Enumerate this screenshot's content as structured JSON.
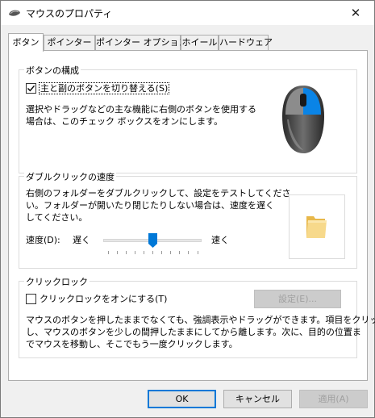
{
  "window": {
    "title": "マウスのプロパティ",
    "close_symbol": "✕"
  },
  "tabs": [
    {
      "label": "ボタン",
      "active": true
    },
    {
      "label": "ポインター",
      "active": false
    },
    {
      "label": "ポインター オプション",
      "active": false
    },
    {
      "label": "ホイール",
      "active": false
    },
    {
      "label": "ハードウェア",
      "active": false
    }
  ],
  "button_config": {
    "group_title": "ボタンの構成",
    "swap_checkbox_label": "主と副のボタンを切り替える(S)",
    "swap_checked": true,
    "description_line1": "選択やドラッグなどの主な機能に右側のボタンを使用する",
    "description_line2": "場合は、このチェック ボックスをオンにします。",
    "mouse_icon": "mouse-right-button-highlighted-icon",
    "highlight_color": "#0a84e6"
  },
  "double_click": {
    "group_title": "ダブルクリックの速度",
    "description_line1": "右側のフォルダーをダブルクリックして、設定をテストしてくださ",
    "description_line2": "い。フォルダーが開いたり閉じたりしない場合は、速度を遅く",
    "description_line3": "してください。",
    "speed_label": "速度(D):",
    "slow_label": "遅く",
    "fast_label": "速く",
    "speed_fraction": 0.5,
    "folder_icon": "folder-icon"
  },
  "click_lock": {
    "group_title": "クリックロック",
    "checkbox_label": "クリックロックをオンにする(T)",
    "checked": false,
    "settings_button": "設定(E)...",
    "description_line1": "マウスのボタンを押したままでなくても、強調表示やドラッグができます。項目をクリック",
    "description_line2": "し、マウスのボタンを少しの間押したままにしてから離します。次に、目的の位置ま",
    "description_line3": "でマウスを移動し、そこでもう一度クリックします。"
  },
  "footer": {
    "ok_label": "OK",
    "cancel_label": "キャンセル",
    "apply_label": "適用(A)"
  },
  "colors": {
    "accent": "#0078d7",
    "slider_thumb": "#0078d7",
    "folder": "#f2d27a"
  }
}
